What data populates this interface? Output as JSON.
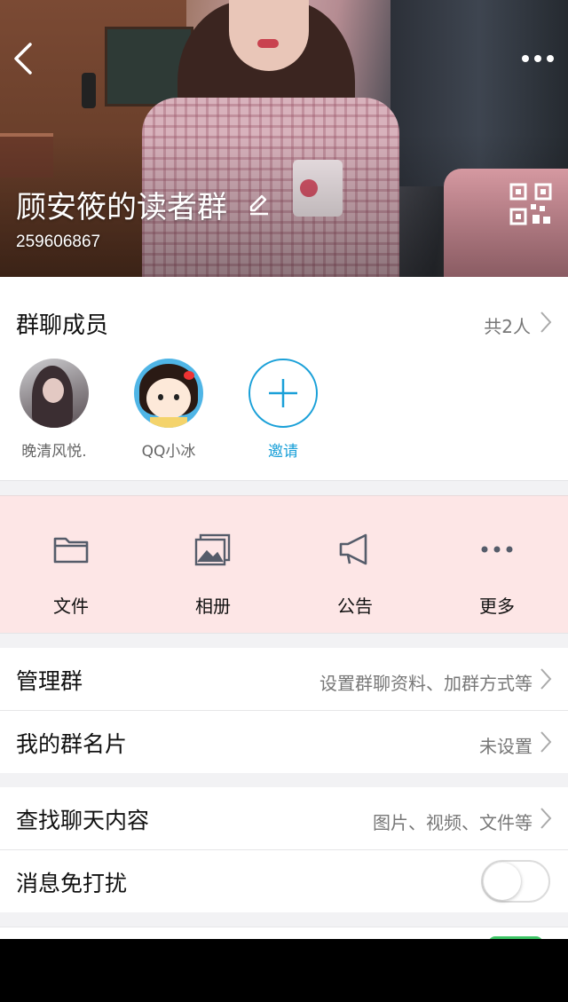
{
  "header": {
    "title": "顾安筱的读者群",
    "group_id": "259606867"
  },
  "members": {
    "title": "群聊成员",
    "count_label": "共2人",
    "list": [
      {
        "name": "晚清风悦."
      },
      {
        "name": "QQ小冰"
      }
    ],
    "invite_label": "邀请"
  },
  "actions": [
    {
      "label": "文件",
      "icon": "folder-icon"
    },
    {
      "label": "相册",
      "icon": "photo-album-icon"
    },
    {
      "label": "公告",
      "icon": "megaphone-icon"
    },
    {
      "label": "更多",
      "icon": "more-dots-icon"
    }
  ],
  "settings": {
    "manage": {
      "label": "管理群",
      "value": "设置群聊资料、加群方式等"
    },
    "card": {
      "label": "我的群名片",
      "value": "未设置"
    },
    "search": {
      "label": "查找聊天内容",
      "value": "图片、视频、文件等"
    },
    "mute": {
      "label": "消息免打扰",
      "enabled": false
    }
  },
  "colors": {
    "accent": "#1aa0d8",
    "action_strip_bg": "#fde6e6",
    "toggle_on": "#3cc464"
  }
}
